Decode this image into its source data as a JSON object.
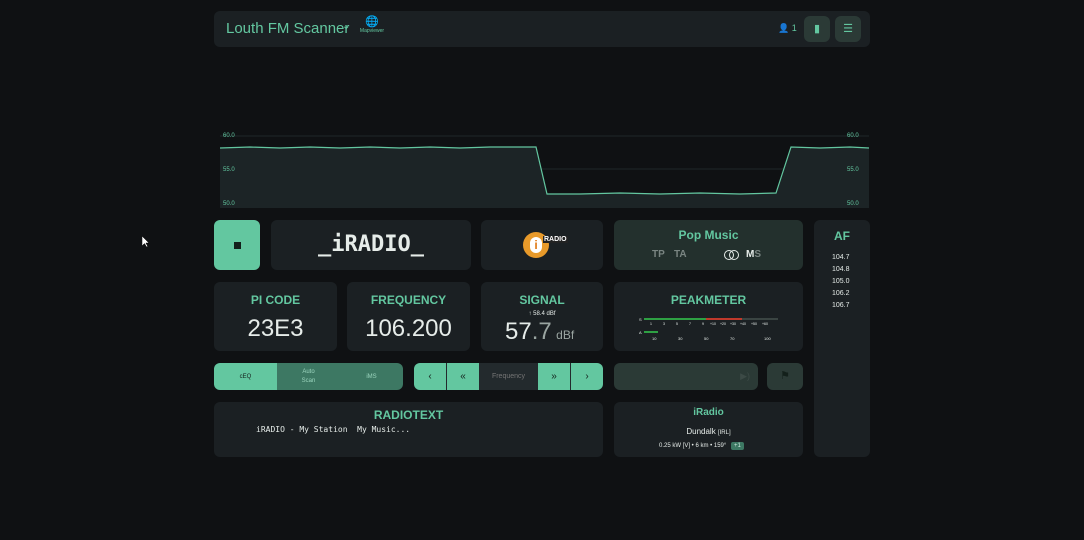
{
  "header": {
    "title": "Louth FM Scanner",
    "mapviewer_label": "Mapviewer",
    "user_count": "1"
  },
  "graph": {
    "y_left": [
      "60.0",
      "55.0",
      "50.0"
    ],
    "y_right": [
      "60.0",
      "55.0",
      "50.0"
    ]
  },
  "station": {
    "ps": "_iRADIO_",
    "logo_text": "RADIO",
    "pty": "Pop Music",
    "tp": "TP",
    "ta": "TA",
    "ms_m": "M",
    "ms_s": "S"
  },
  "pi": {
    "label": "PI CODE",
    "value": "23E3"
  },
  "frequency": {
    "label": "FREQUENCY",
    "value": "106.200",
    "input_placeholder": "Frequency"
  },
  "signal": {
    "label": "SIGNAL",
    "peak": "58.4 dBf",
    "value_int": "57",
    "value_dec": ".7",
    "unit": "dBf"
  },
  "peakmeter": {
    "label": "PEAKMETER",
    "s_label": "S",
    "a_label": "A",
    "scale_top": [
      "1",
      "3",
      "5",
      "7",
      "9",
      "+10",
      "+20",
      "+30",
      "+40",
      "+50",
      "+60"
    ],
    "scale_bottom": [
      "10",
      "30",
      "50",
      "70",
      "100"
    ]
  },
  "controls": {
    "ceq": "cEQ",
    "autoscan_1": "Auto",
    "autoscan_2": "Scan",
    "ims": "iMS",
    "prev": "‹",
    "prev_fast": "«",
    "next_fast": "»",
    "next": "›"
  },
  "radiotext": {
    "label": "RADIOTEXT",
    "text": "iRADIO - My Station  My Music..."
  },
  "tx": {
    "name": "iRadio",
    "city": "Dundalk",
    "country": "[IRL]",
    "details": "0.25 kW [V] • 6 km • 159°",
    "badge": "+1"
  },
  "af": {
    "label": "AF",
    "list": [
      "104.7",
      "104.8",
      "105.0",
      "106.2",
      "106.7"
    ]
  },
  "colors": {
    "accent": "#63c7a0",
    "panel": "#1b2023",
    "bg": "#0f1113",
    "peak_red": "#c0392b"
  }
}
